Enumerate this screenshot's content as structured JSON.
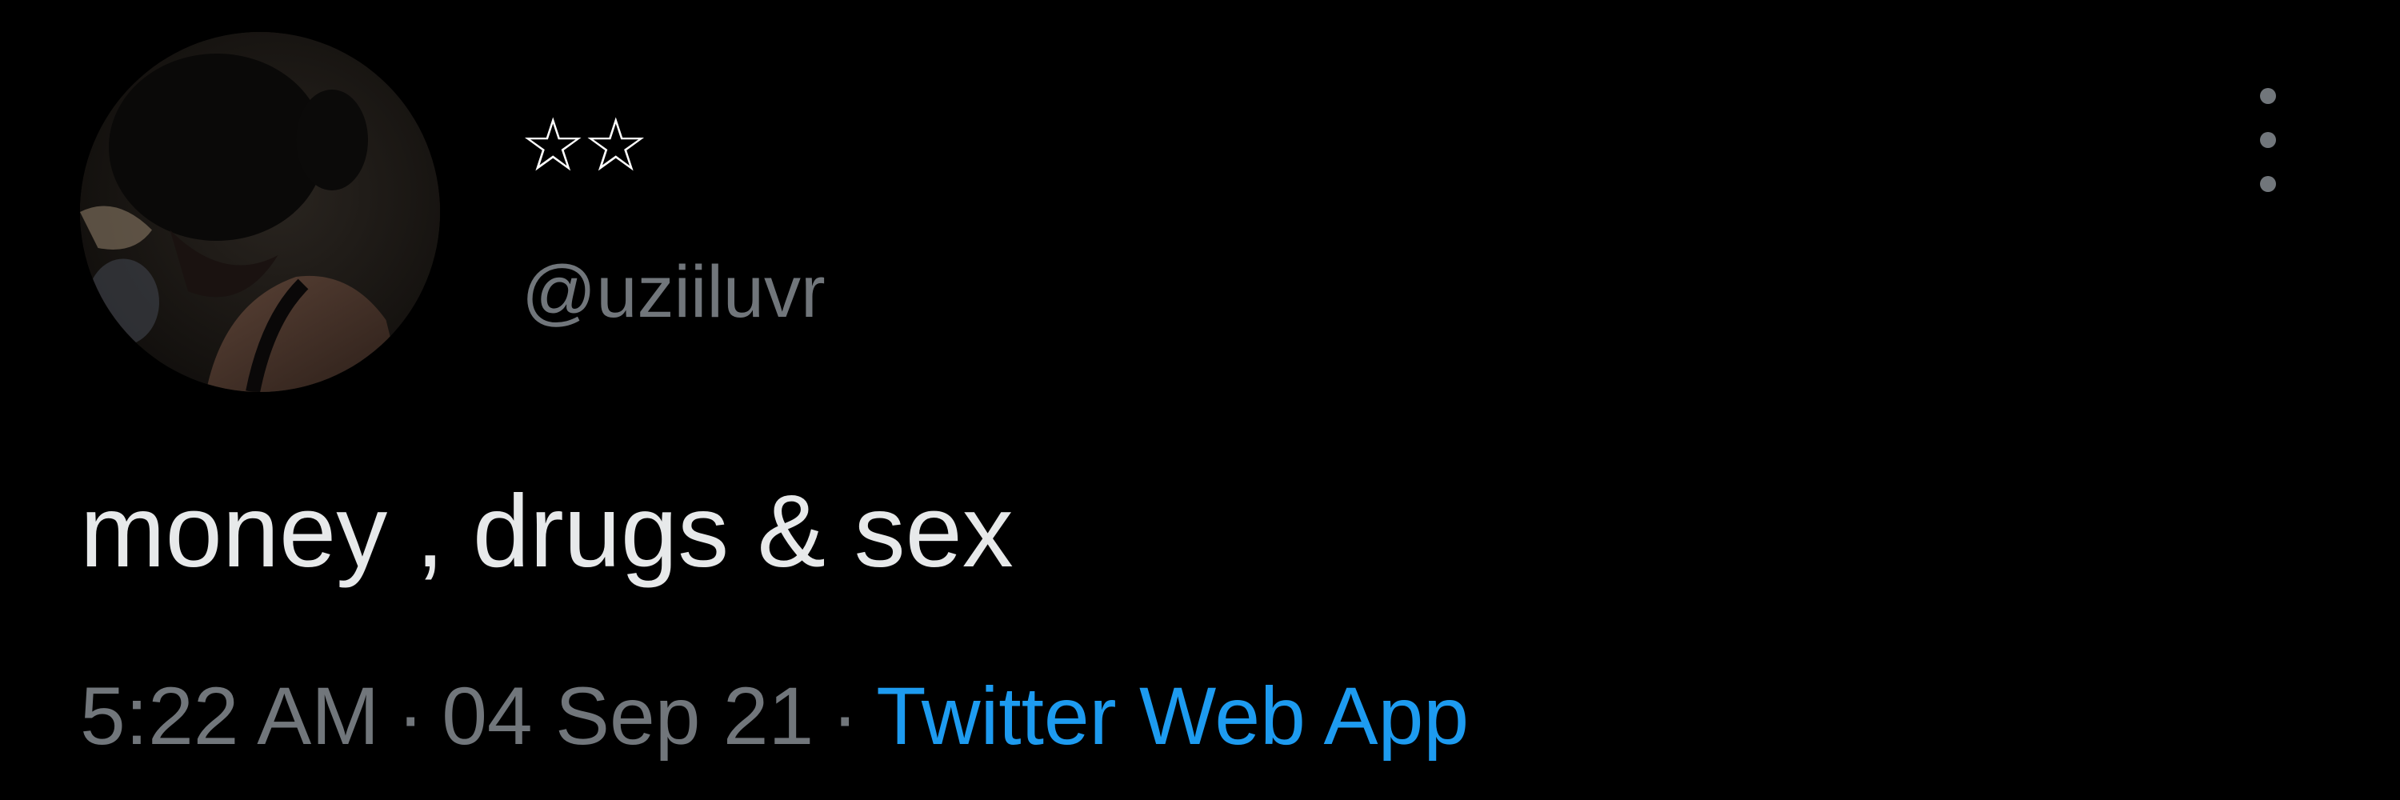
{
  "tweet": {
    "display_name": "☆☆",
    "handle": "@uziiluvr",
    "text": "money , drugs & sex",
    "time": "5:22 AM",
    "separator": "·",
    "date": "04 Sep 21",
    "source": "Twitter Web App"
  },
  "icons": {
    "more": "more-vertical-icon",
    "avatar": "avatar-image"
  },
  "colors": {
    "background": "#000000",
    "primary_text": "#e7e9ea",
    "secondary_text": "#71767b",
    "link": "#1d9bf0"
  }
}
